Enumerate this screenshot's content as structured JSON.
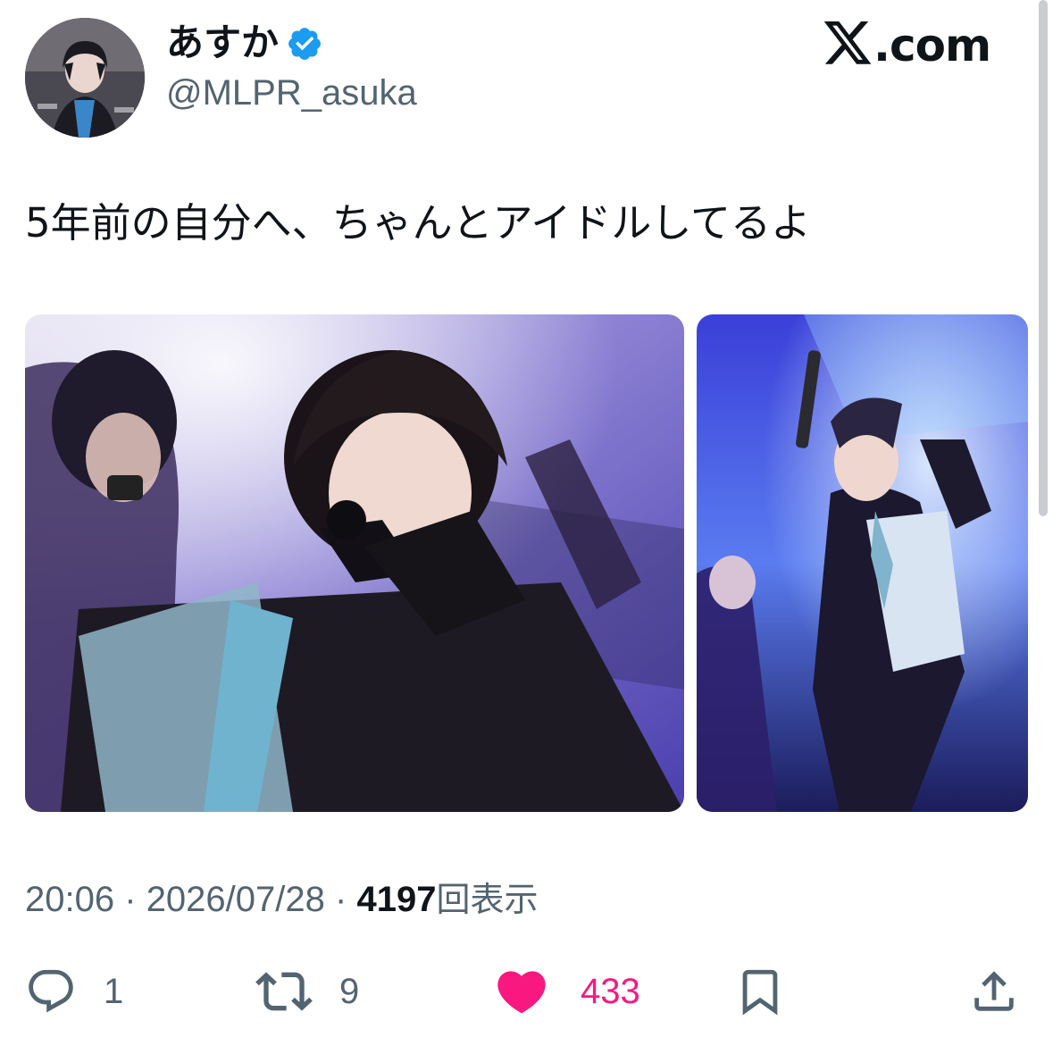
{
  "user": {
    "display_name": "あすか",
    "handle": "@MLPR_asuka",
    "verified": true,
    "verified_color": "#1d9bf0"
  },
  "brand": {
    "logo_text": ".com",
    "logo_icon": "x-logo-icon"
  },
  "tweet": {
    "text": "5年前の自分へ、ちゃんとアイドルしてるよ",
    "media_count": 2
  },
  "meta": {
    "time": "20:06",
    "separator": "·",
    "date": "2026/07/28",
    "views_count": "4197",
    "views_label": "回表示"
  },
  "actions": {
    "reply_count": "1",
    "retweet_count": "9",
    "like_count": "433",
    "like_color": "#f91880",
    "liked": true
  }
}
